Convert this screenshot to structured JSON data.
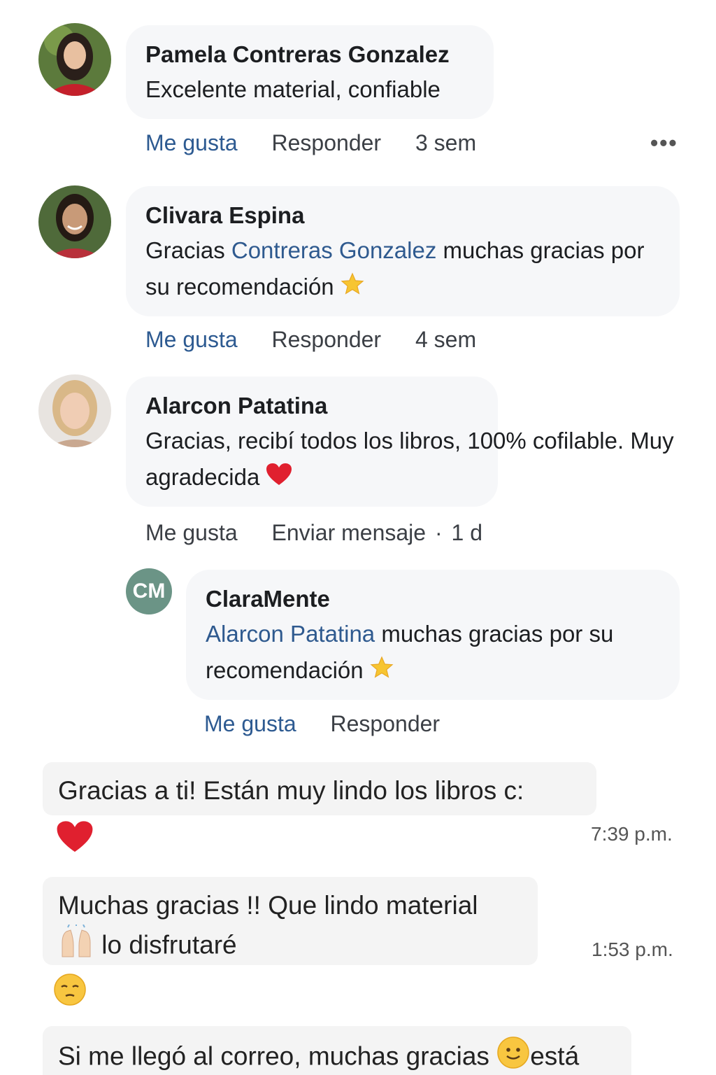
{
  "comments": [
    {
      "author": "Pamela Contreras Gonzalez",
      "text": "Excelente material, confiable",
      "like_label": "Me gusta",
      "reply_label": "Responder",
      "time": "3 sem",
      "more": "•••"
    },
    {
      "author": "Clivara Espina",
      "text_pre": "Gracias ",
      "mention": "Contreras Gonzalez",
      "text_post": " muchas gracias por su recomendación",
      "like_label": "Me gusta",
      "reply_label": "Responder",
      "time": "4 sem"
    },
    {
      "author": "Alarcon Patatina",
      "text": "Gracias, recibí todos los libros, 100% cofilable. Muy agradecida",
      "like_label": "Me gusta",
      "message_label": "Enviar mensaje",
      "separator": "·",
      "time": "1 d"
    }
  ],
  "reply": {
    "avatar_initials": "CM",
    "author": "ClaraMente",
    "mention": "Alarcon Patatina",
    "text": " muchas gracias por su recomendación",
    "like_label": "Me gusta",
    "reply_label": "Responder"
  },
  "messages": [
    {
      "text": "Gracias a ti! Están muy lindo los libros c:",
      "time": "7:39 p.m."
    },
    {
      "line1": "Muchas gracias !! Que lindo material",
      "line2": "lo disfrutaré",
      "time": "1:53 p.m."
    },
    {
      "text_pre": "Si me llegó al correo, muchas gracias ",
      "text_post": "está"
    }
  ],
  "icons": [
    "star-icon",
    "heart-icon",
    "raising-hands-icon",
    "relieved-face-icon",
    "smiling-face-icon",
    "more-icon"
  ],
  "colors": {
    "link": "#2d5a91",
    "bubble": "#f6f7f9",
    "cm_avatar": "#6b9486",
    "heart": "#e0202f",
    "star": "#f7c531"
  }
}
